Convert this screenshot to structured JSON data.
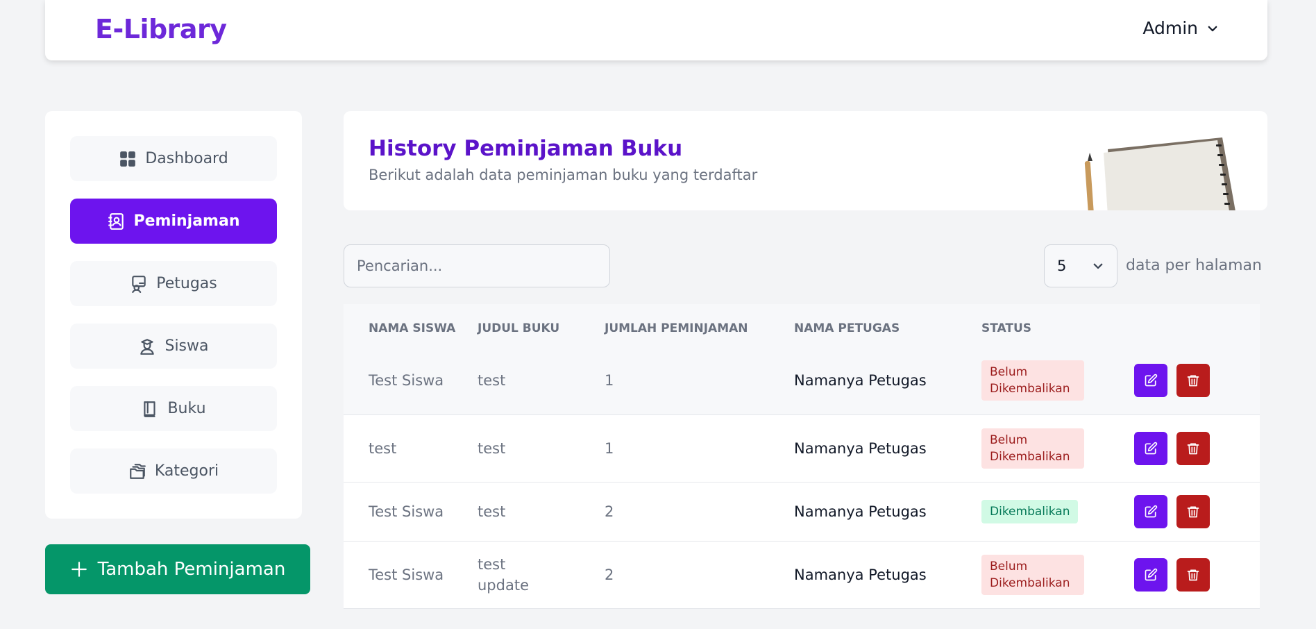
{
  "app": {
    "brand": "E-Library",
    "user": "Admin"
  },
  "sidebar": {
    "items": [
      {
        "label": "Dashboard",
        "icon": "dashboard-icon",
        "active": false
      },
      {
        "label": "Peminjaman",
        "icon": "contact-book-icon",
        "active": true
      },
      {
        "label": "Petugas",
        "icon": "staff-icon",
        "active": false
      },
      {
        "label": "Siswa",
        "icon": "student-icon",
        "active": false
      },
      {
        "label": "Buku",
        "icon": "book-icon",
        "active": false
      },
      {
        "label": "Kategori",
        "icon": "folders-icon",
        "active": false
      }
    ],
    "add_button": "Tambah Peminjaman"
  },
  "header": {
    "title": "History Peminjaman Buku",
    "subtitle": "Berikut adalah data peminjaman buku yang terdaftar"
  },
  "controls": {
    "search_placeholder": "Pencarian...",
    "per_page_value": "5",
    "per_page_label": "data per halaman"
  },
  "table": {
    "columns": [
      "Nama Siswa",
      "Judul Buku",
      "Jumlah Peminjaman",
      "Nama Petugas",
      "Status"
    ],
    "rows": [
      {
        "nama_siswa": "Test Siswa",
        "judul_buku": "test",
        "jumlah": "1",
        "petugas": "Namanya Petugas",
        "status": "Belum Dikembalikan",
        "returned": false
      },
      {
        "nama_siswa": "test",
        "judul_buku": "test",
        "jumlah": "1",
        "petugas": "Namanya Petugas",
        "status": "Belum Dikembalikan",
        "returned": false
      },
      {
        "nama_siswa": "Test Siswa",
        "judul_buku": "test",
        "jumlah": "2",
        "petugas": "Namanya Petugas",
        "status": "Dikembalikan",
        "returned": true
      },
      {
        "nama_siswa": "Test Siswa",
        "judul_buku": "test update",
        "jumlah": "2",
        "petugas": "Namanya Petugas",
        "status": "Belum Dikembalikan",
        "returned": false
      }
    ]
  },
  "colors": {
    "brand": "#6d28d9",
    "primary": "#6d14ee",
    "success": "#059669",
    "danger": "#b91c1c"
  }
}
